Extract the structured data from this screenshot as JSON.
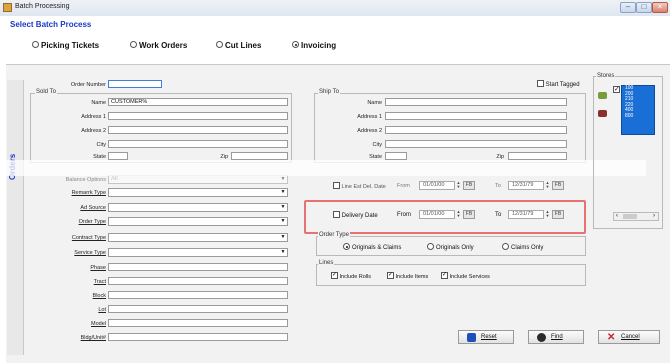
{
  "window": {
    "title": "Batch Processing"
  },
  "select_batch": {
    "title": "Select Batch Process",
    "options": [
      {
        "label": "Picking Tickets",
        "selected": false
      },
      {
        "label": "Work Orders",
        "selected": false
      },
      {
        "label": "Cut Lines",
        "selected": false
      },
      {
        "label": "Invoicing",
        "selected": true
      }
    ]
  },
  "side_tab": "Orders",
  "order_number_label": "Order Number",
  "order_number_value": "",
  "sold_to": {
    "title": "Sold To",
    "name_label": "Name",
    "name_value": "CUSTOMER%",
    "address1_label": "Address 1",
    "address2_label": "Address 2",
    "city_label": "City",
    "state_label": "State",
    "zip_label": "Zip"
  },
  "start_tagged_label": "Start Tagged",
  "ship_to": {
    "title": "Ship To",
    "name_label": "Name",
    "address1_label": "Address 1",
    "address2_label": "Address 2",
    "city_label": "City",
    "state_label": "State",
    "zip_label": "Zip"
  },
  "partial_row": {
    "label": "Balance Options",
    "value": "All"
  },
  "combos": [
    {
      "label": "Remarrk Type"
    },
    {
      "label": "Ad Source"
    },
    {
      "label": "Order Type"
    },
    {
      "label": "Contract Type"
    },
    {
      "label": "Service Type"
    }
  ],
  "text_fields": [
    {
      "label": "Phase"
    },
    {
      "label": "Tract"
    },
    {
      "label": "Block"
    },
    {
      "label": "Lot"
    },
    {
      "label": "Model"
    },
    {
      "label": "Bldg/Unit#"
    }
  ],
  "line_est_del": {
    "label": "Line Est Del. Date",
    "from_label": "From",
    "from_value": "01/01/00",
    "to_label": "To",
    "to_value": "12/31/79",
    "fb_label": "FB"
  },
  "delivery_date": {
    "label": "Delivery Date",
    "from_label": "From",
    "from_value": "01/01/00",
    "to_label": "To",
    "to_value": "12/31/79",
    "fb_label": "FB"
  },
  "order_type_group": {
    "title": "Order Type",
    "options": [
      {
        "label": "Originals & Claims",
        "selected": true
      },
      {
        "label": "Originals Only",
        "selected": false
      },
      {
        "label": "Claims Only",
        "selected": false
      }
    ]
  },
  "lines_group": {
    "title": "Lines",
    "checks": [
      {
        "label": "Include Rolls",
        "checked": true
      },
      {
        "label": "Include Items",
        "checked": true
      },
      {
        "label": "Include Services",
        "checked": true
      }
    ]
  },
  "stores": {
    "title": "Stores",
    "codes": [
      "100",
      "200",
      "210",
      "220",
      "400",
      "800"
    ]
  },
  "buttons": {
    "reset": "Reset",
    "find": "Find",
    "cancel": "Cancel"
  },
  "colors": {
    "accent": "#1b39c7",
    "highlight": "#e57373",
    "selection": "#1a6fd6"
  }
}
